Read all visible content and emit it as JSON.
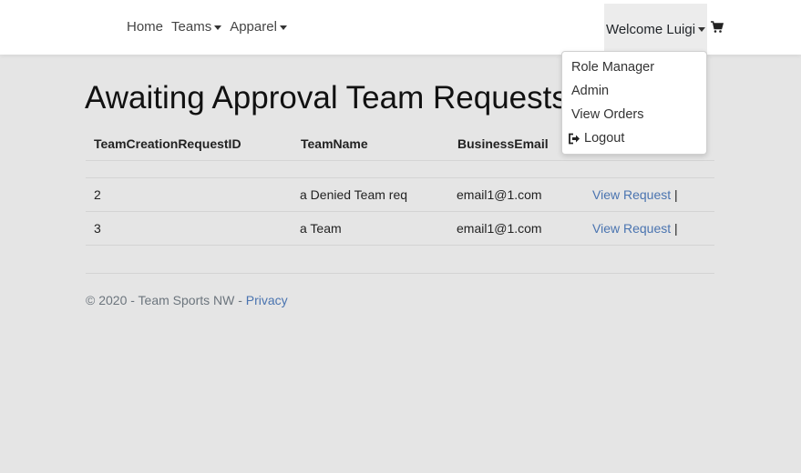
{
  "nav": {
    "home": "Home",
    "teams": "Teams",
    "apparel": "Apparel",
    "welcome": "Welcome Luigi"
  },
  "dropdown": {
    "items": [
      "Role Manager",
      "Admin",
      "View Orders"
    ],
    "logout": "Logout"
  },
  "page": {
    "title": "Awaiting Approval Team Requests"
  },
  "table": {
    "headers": [
      "TeamCreationRequestID",
      "TeamName",
      "BusinessEmail",
      ""
    ],
    "rows": [
      {
        "id": "2",
        "name": "a Denied Team req",
        "email": "email1@1.com",
        "action": "View Request",
        "sep": "|"
      },
      {
        "id": "3",
        "name": "a Team",
        "email": "email1@1.com",
        "action": "View Request",
        "sep": "|"
      }
    ]
  },
  "footer": {
    "copyright": "© 2020 - Team Sports NW - ",
    "privacy": "Privacy"
  }
}
